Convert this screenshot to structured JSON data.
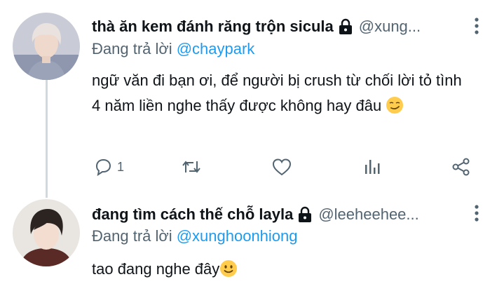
{
  "tweets": [
    {
      "display_name": "thà ăn kem đánh răng trộn sicula",
      "handle": "@xung...",
      "reply_prefix": "Đang trả lời",
      "reply_to": "@chaypark",
      "text": "ngữ văn đi bạn ơi, để người bị crush từ chối lời tỏ tình 4 năm liền nghe thấy được không hay đâu",
      "emoji_icon": "smirk-emoji",
      "reply_count": "1",
      "protected": true
    },
    {
      "display_name": "đang tìm cách thế chỗ layla",
      "handle": "@leeheehee...",
      "reply_prefix": "Đang trả lời",
      "reply_to": "@xunghoonhiong",
      "text": "tao đang nghe đây",
      "emoji_icon": "slightly-smiling-emoji",
      "protected": true
    }
  ],
  "action_icons": [
    "reply-icon",
    "retweet-icon",
    "like-icon",
    "analytics-icon",
    "share-icon"
  ],
  "colors": {
    "text": "#0f1419",
    "secondary": "#536471",
    "mention": "#1d9bf0",
    "thread_line": "#cfd9de"
  }
}
